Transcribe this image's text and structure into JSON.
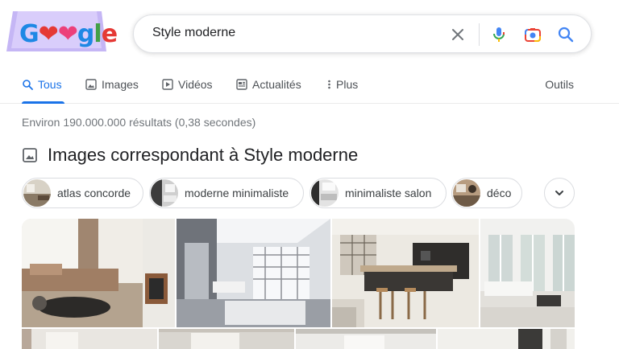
{
  "search": {
    "query": "Style moderne"
  },
  "tabs": [
    {
      "label": "Tous"
    },
    {
      "label": "Images"
    },
    {
      "label": "Vidéos"
    },
    {
      "label": "Actualités"
    },
    {
      "label": "Plus"
    }
  ],
  "tools_label": "Outils",
  "result_stats": "Environ 190.000.000 résultats (0,38 secondes)",
  "images_section": {
    "title": "Images correspondant à Style moderne",
    "chips": [
      {
        "label": "atlas concorde"
      },
      {
        "label": "moderne minimaliste"
      },
      {
        "label": "minimaliste salon"
      },
      {
        "label": "déco"
      }
    ]
  },
  "colors": {
    "accent": "#1a73e8",
    "logo_bg": "#b9a8f0"
  }
}
